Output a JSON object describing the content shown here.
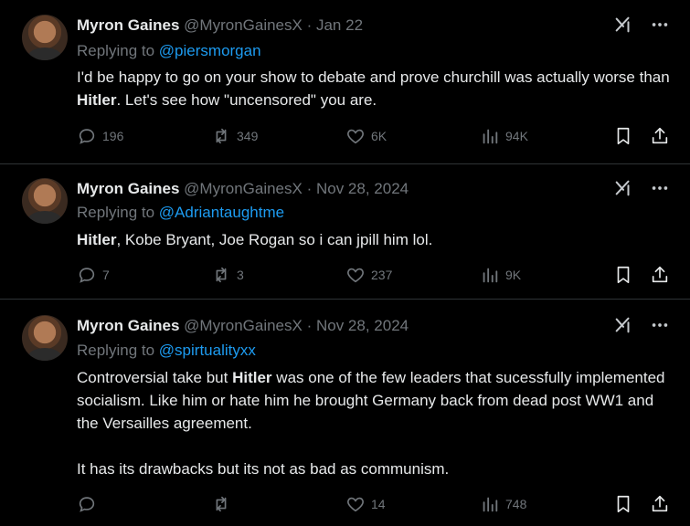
{
  "tweets": [
    {
      "name": "Myron Gaines",
      "handle": "@MyronGainesX",
      "date": "· Jan 22",
      "replying_prefix": "Replying to",
      "replying_to": "@piersmorgan",
      "body": [
        {
          "t": "I'd be happy to go on your show to debate and prove churchill was actually worse than ",
          "b": false
        },
        {
          "t": "Hitler",
          "b": true
        },
        {
          "t": ". Let's see how \"uncensored\" you are.",
          "b": false
        }
      ],
      "replies": "196",
      "reposts": "349",
      "likes": "6K",
      "views": "94K"
    },
    {
      "name": "Myron Gaines",
      "handle": "@MyronGainesX",
      "date": "· Nov 28, 2024",
      "replying_prefix": "Replying to",
      "replying_to": "@Adriantaughtme",
      "body": [
        {
          "t": "Hitler",
          "b": true
        },
        {
          "t": ", Kobe Bryant, Joe Rogan so i can jpill him lol.",
          "b": false
        }
      ],
      "replies": "7",
      "reposts": "3",
      "likes": "237",
      "views": "9K"
    },
    {
      "name": "Myron Gaines",
      "handle": "@MyronGainesX",
      "date": "· Nov 28, 2024",
      "replying_prefix": "Replying to",
      "replying_to": "@spirtualityxx",
      "body": [
        {
          "t": "Controversial take but ",
          "b": false
        },
        {
          "t": "Hitler",
          "b": true
        },
        {
          "t": " was one of the few leaders that sucessfully implemented socialism. Like him or hate him he brought Germany back from dead post WW1 and the Versailles agreement.",
          "b": false
        },
        {
          "t": "\n\nIt has its drawbacks but its not as bad as communism.",
          "b": false
        }
      ],
      "replies": "",
      "reposts": "",
      "likes": "14",
      "views": "748"
    }
  ],
  "colors": {
    "accent": "#1d9bf0",
    "muted": "#71767b",
    "text": "#e7e9ea",
    "divider": "#2f3336"
  },
  "icons": [
    "grok-icon",
    "more-icon",
    "reply-icon",
    "repost-icon",
    "like-icon",
    "views-icon",
    "bookmark-icon",
    "share-icon"
  ]
}
